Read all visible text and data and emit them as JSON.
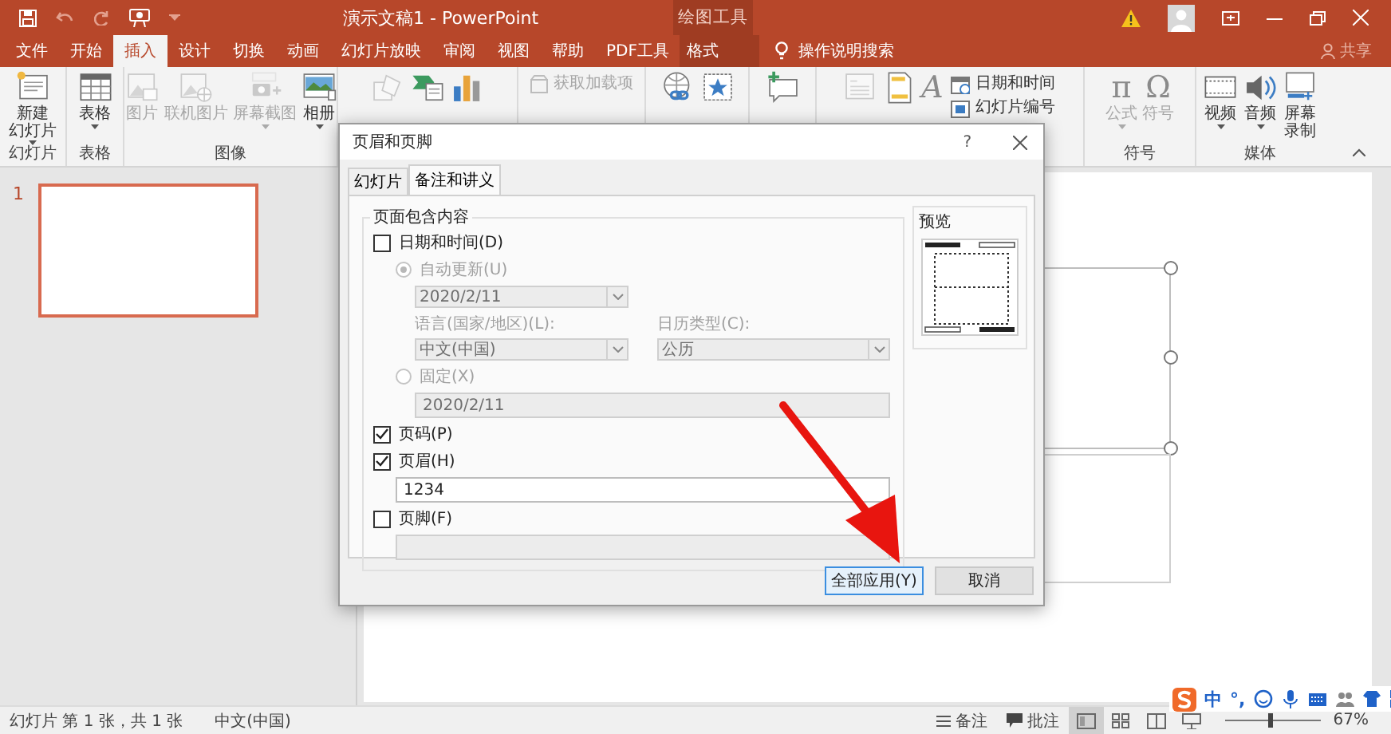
{
  "title_bar": {
    "title": "演示文稿1  -  PowerPoint",
    "context_label": "绘图工具"
  },
  "ribbon_tabs": [
    {
      "label": "文件",
      "selected": false,
      "kind": "normal"
    },
    {
      "label": "开始",
      "selected": false,
      "kind": "normal"
    },
    {
      "label": "插入",
      "selected": true,
      "kind": "normal"
    },
    {
      "label": "设计",
      "selected": false,
      "kind": "normal"
    },
    {
      "label": "切换",
      "selected": false,
      "kind": "normal"
    },
    {
      "label": "动画",
      "selected": false,
      "kind": "normal"
    },
    {
      "label": "幻灯片放映",
      "selected": false,
      "kind": "normal"
    },
    {
      "label": "审阅",
      "selected": false,
      "kind": "normal"
    },
    {
      "label": "视图",
      "selected": false,
      "kind": "normal"
    },
    {
      "label": "帮助",
      "selected": false,
      "kind": "normal"
    },
    {
      "label": "PDF工具",
      "selected": false,
      "kind": "normal"
    },
    {
      "label": "格式",
      "selected": false,
      "kind": "context"
    }
  ],
  "tell_me": "操作说明搜索",
  "share": "共享",
  "ribbon_groups": [
    {
      "label": "幻灯片",
      "items": [
        {
          "kind": "new-slide",
          "compact": false,
          "label": "新建",
          "label_2": "幻灯片",
          "dropdown": true,
          "disabled": false
        }
      ]
    },
    {
      "label": "表格",
      "items": [
        {
          "kind": "table",
          "compact": false,
          "label": "表格",
          "dropdown": true,
          "disabled": false
        }
      ]
    },
    {
      "label": "图像",
      "items": [
        {
          "kind": "picture",
          "compact": false,
          "label": "图片",
          "dropdown": false,
          "disabled": true
        },
        {
          "kind": "online-picture",
          "compact": false,
          "label": "联机图片",
          "dropdown": false,
          "disabled": true
        },
        {
          "kind": "screenshot",
          "compact": false,
          "label": "屏幕截图",
          "dropdown": true,
          "disabled": true
        },
        {
          "kind": "album",
          "compact": false,
          "label": "相册",
          "dropdown": true,
          "disabled": false
        }
      ]
    },
    {
      "items": [
        {
          "kind": "shapes",
          "compact": false,
          "dropdown": false,
          "disabled": true
        },
        {
          "kind": "smartart",
          "compact": false,
          "dropdown": false,
          "disabled": false
        },
        {
          "kind": "chart",
          "compact": false,
          "dropdown": false,
          "disabled": false
        }
      ]
    },
    {
      "items": [
        {
          "kind": "addin",
          "compact": true,
          "label": "获取加载项",
          "dropdown": false,
          "disabled": true
        }
      ]
    },
    {
      "items": [
        {
          "kind": "link",
          "compact": false,
          "dropdown": false,
          "disabled": false
        },
        {
          "kind": "action",
          "compact": false,
          "dropdown": false,
          "disabled": false
        }
      ]
    },
    {
      "items": [
        {
          "kind": "comment",
          "compact": false,
          "dropdown": false,
          "disabled": false
        }
      ]
    },
    {
      "items": [
        {
          "kind": "textbox",
          "compact": false,
          "dropdown": false,
          "disabled": true
        },
        {
          "kind": "header-footer",
          "compact": false,
          "dropdown": false,
          "disabled": false
        },
        {
          "kind": "wordart",
          "compact": false,
          "glyph": "A",
          "dropdown": false,
          "disabled": true
        },
        {
          "kind": "date-time",
          "compact": true,
          "label": "日期和时间",
          "dropdown": false,
          "disabled": false
        },
        {
          "kind": "slide-number",
          "compact": true,
          "label": "幻灯片编号",
          "dropdown": false,
          "disabled": false
        }
      ]
    },
    {
      "label": "符号",
      "items": [
        {
          "kind": "equation",
          "compact": false,
          "glyph": "π",
          "label": "公式",
          "dropdown": true,
          "disabled": true
        },
        {
          "kind": "symbol",
          "compact": false,
          "glyph": "Ω",
          "label": "符号",
          "dropdown": false,
          "disabled": true
        }
      ]
    },
    {
      "label": "媒体",
      "items": [
        {
          "kind": "video",
          "compact": false,
          "label": "视频",
          "dropdown": true,
          "disabled": false
        },
        {
          "kind": "audio",
          "compact": false,
          "label": "音频",
          "dropdown": true,
          "disabled": false
        },
        {
          "kind": "screen-recording",
          "compact": false,
          "label": "屏幕",
          "label_2": "录制",
          "dropdown": false,
          "disabled": false
        }
      ]
    }
  ],
  "slides": [
    {
      "number": "1",
      "selected": true
    }
  ],
  "dialog": {
    "title": "页眉和页脚",
    "help": "?",
    "tabs": [
      {
        "label": "幻灯片",
        "selected": false
      },
      {
        "label": "备注和讲义",
        "selected": true
      }
    ],
    "group_title": "页面包含内容",
    "date_time": {
      "label": "日期和时间(D)",
      "checked": false
    },
    "auto_update": {
      "label": "自动更新(U)",
      "selected": true,
      "disabled": true
    },
    "date_value": {
      "value": "2020/2/11",
      "disabled": true
    },
    "language": {
      "label": "语言(国家/地区)(L):",
      "value": "中文(中国)",
      "disabled": true
    },
    "calendar": {
      "label": "日历类型(C):",
      "value": "公历",
      "disabled": true
    },
    "fixed": {
      "label": "固定(X)",
      "selected": false,
      "disabled": true
    },
    "fixed_value": {
      "value": "2020/2/11",
      "disabled": true
    },
    "slide_number": {
      "label": "页码(P)",
      "checked": true
    },
    "header": {
      "label": "页眉(H)",
      "checked": true
    },
    "header_text": {
      "value": "1234",
      "disabled": false
    },
    "footer": {
      "label": "页脚(F)",
      "checked": false
    },
    "footer_text": {
      "disabled": true
    },
    "preview_label": "预览",
    "buttons": [
      {
        "label": "全部应用(Y)",
        "default": true
      },
      {
        "label": "取消",
        "default": false
      }
    ]
  },
  "ime": {
    "mode": "中",
    "punctuation": "°,"
  },
  "status_bar": {
    "slide_info": "幻灯片 第 1 张，共 1 张",
    "language": "中文(中国)",
    "notes": "备注",
    "comments": "批注",
    "views": [
      {
        "kind": "normal",
        "selected": true
      },
      {
        "kind": "sorter",
        "selected": false
      },
      {
        "kind": "reading",
        "selected": false
      },
      {
        "kind": "slideshow",
        "selected": false
      }
    ],
    "zoom": {
      "level": 0.45,
      "reading": "67%"
    }
  }
}
